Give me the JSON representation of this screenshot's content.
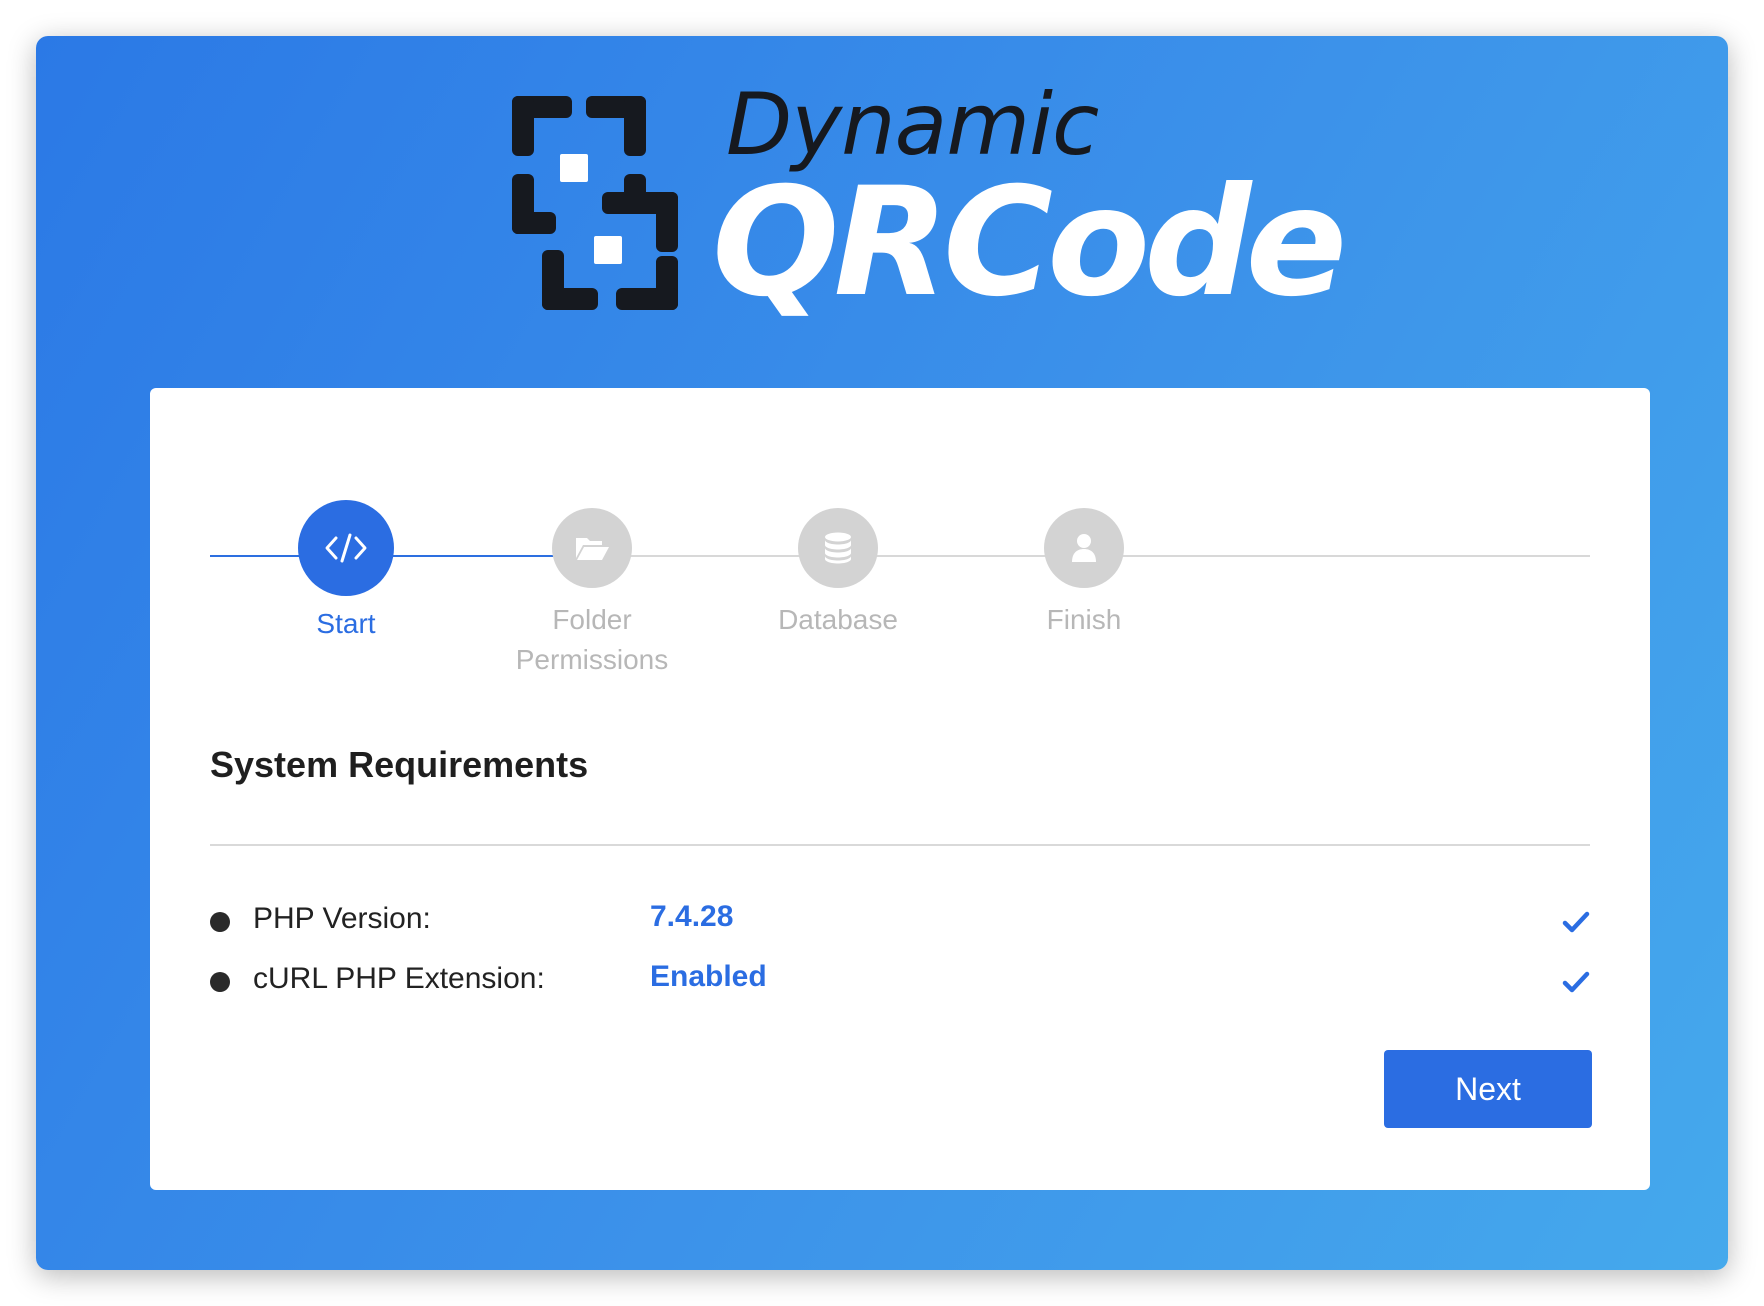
{
  "logo": {
    "line1": "Dynamic",
    "line2": "QRCode",
    "mark_icon": "qr-bracket-logo-icon"
  },
  "stepper": {
    "steps": [
      {
        "label": "Start",
        "icon": "code-icon",
        "active": true
      },
      {
        "label": "Folder Permissions",
        "icon": "folder-open-icon",
        "active": false
      },
      {
        "label": "Database",
        "icon": "database-icon",
        "active": false
      },
      {
        "label": "Finish",
        "icon": "user-icon",
        "active": false
      }
    ]
  },
  "requirements": {
    "title": "System Requirements",
    "items": [
      {
        "label": "PHP Version:",
        "value": "7.4.28",
        "status_icon": "check-icon"
      },
      {
        "label": "cURL PHP Extension:",
        "value": "Enabled",
        "status_icon": "check-icon"
      }
    ]
  },
  "actions": {
    "next_label": "Next"
  },
  "colors": {
    "primary": "#2b6de2",
    "background_gradient_start": "#2b79e6",
    "background_gradient_end": "#45a9ec",
    "inactive_step": "#d3d3d3",
    "inactive_text": "#b7b7b7"
  }
}
